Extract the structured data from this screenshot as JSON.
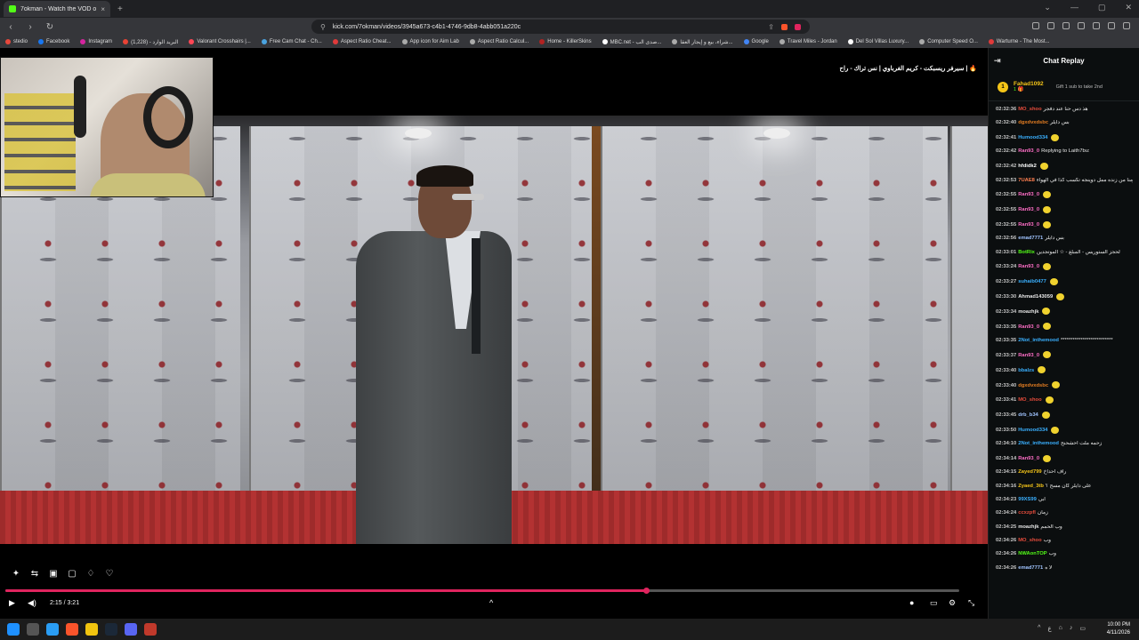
{
  "browser": {
    "tab_title": "7okman - Watch the VOD on...",
    "tab_close": "×",
    "new_tab": "+",
    "url": "kick.com/7okman/videos/3945a673-c4b1-4746-9db8-4abb051a220c",
    "bookmarks": [
      {
        "label": "stedio",
        "color": "#e8483c"
      },
      {
        "label": "Facebook",
        "color": "#1877f2"
      },
      {
        "label": "Instagram",
        "color": "#d6249f"
      },
      {
        "label": "البريد الوارد - (1,228)",
        "color": "#ea4335"
      },
      {
        "label": "Valorant Crosshairs |...",
        "color": "#ff4655"
      },
      {
        "label": "Free Cam Chat - Ch...",
        "color": "#4aa3df"
      },
      {
        "label": "Aspect Ratio Cheat...",
        "color": "#e03a3a"
      },
      {
        "label": "App icon for Aim Lab",
        "color": "#aaaaaa"
      },
      {
        "label": "Aspect Ratio Calcul...",
        "color": "#aaaaaa"
      },
      {
        "label": "Home - KillerSkins",
        "color": "#b22222"
      },
      {
        "label": "MBC.net - صدى الب...",
        "color": "#ffffff"
      },
      {
        "label": "شراء، بيع و إيجار العقا...",
        "color": "#aaaaaa"
      },
      {
        "label": "Google",
        "color": "#4285f4"
      },
      {
        "label": "Travel Miles - Jordan",
        "color": "#aaaaaa"
      },
      {
        "label": "Del Sol Villas Luxury...",
        "color": "#ffffff"
      },
      {
        "label": "Computer Speed O...",
        "color": "#aaaaaa"
      },
      {
        "label": "Warturne - The Most...",
        "color": "#e03a3a"
      }
    ]
  },
  "player": {
    "video_title": "🔥 | سيرفر ريسبكت - كريم الغرباوي | نس تراك - راح",
    "time": "2:15 / 3:21",
    "progress_fraction": 0.672
  },
  "chat": {
    "title": "Chat Replay",
    "gifter": {
      "rank": "1",
      "name": "Fahad1092",
      "count": "1 🎁",
      "gift_text": "Gift 1 sub to take 2nd"
    },
    "messages": [
      {
        "ts": "02:32:36",
        "user": "MO_shoo",
        "color": "#e74c3c",
        "text": "هذ دس حنا عند دفجر"
      },
      {
        "ts": "02:32:40",
        "user": "dgxdvxdsbc",
        "color": "#e67e22",
        "text": "بس دايلر"
      },
      {
        "ts": "02:32:41",
        "user": "Humood334",
        "color": "#3ab0ff",
        "text": ""
      },
      {
        "ts": "02:32:42",
        "user": "Ran93_0",
        "color": "#ff6ec7",
        "text": "Replying to Laith7bu:"
      },
      {
        "ts": "02:32:42",
        "user": "hfdidk2",
        "color": "#ffffff",
        "text": ""
      },
      {
        "ts": "02:32:53",
        "user": "7UAE8",
        "color": "#ff7f50",
        "text": "بحول قولو له زمنا من زنده ممل دوينجه تكسب كذا في الهواء"
      },
      {
        "ts": "02:32:55",
        "user": "Ran93_0",
        "color": "#ff6ec7",
        "text": ""
      },
      {
        "ts": "02:32:55",
        "user": "Ran93_0",
        "color": "#ff6ec7",
        "text": ""
      },
      {
        "ts": "02:32:55",
        "user": "Ran93_0",
        "color": "#ff6ec7",
        "text": ""
      },
      {
        "ts": "02:32:56",
        "user": "emad7771",
        "color": "#a0c4ff",
        "text": "بس دايلر"
      },
      {
        "ts": "02:33:01",
        "user": "BotRix",
        "color": "#53fc18",
        "text": "لحجز الستوريس - المبلغ - ☆ الموتجدين"
      },
      {
        "ts": "02:33:24",
        "user": "Ran93_0",
        "color": "#ff6ec7",
        "text": ""
      },
      {
        "ts": "02:33:27",
        "user": "suhaib0477",
        "color": "#3ab0ff",
        "text": ""
      },
      {
        "ts": "02:33:30",
        "user": "Ahmad143059",
        "color": "#e8e8e8",
        "text": ""
      },
      {
        "ts": "02:33:34",
        "user": "moazhjk",
        "color": "#e8e8e8",
        "text": ""
      },
      {
        "ts": "02:33:35",
        "user": "Ran93_0",
        "color": "#ff6ec7",
        "text": ""
      },
      {
        "ts": "02:33:35",
        "user": "2Not_inthemood",
        "color": "#3ab0ff",
        "text": "**************************"
      },
      {
        "ts": "02:33:37",
        "user": "Ran93_0",
        "color": "#ff6ec7",
        "text": ""
      },
      {
        "ts": "02:33:40",
        "user": "bbalzs",
        "color": "#3ab0ff",
        "text": ""
      },
      {
        "ts": "02:33:40",
        "user": "dgxdvxdsbc",
        "color": "#e67e22",
        "text": ""
      },
      {
        "ts": "02:33:41",
        "user": "MO_shoo",
        "color": "#e74c3c",
        "text": ""
      },
      {
        "ts": "02:33:45",
        "user": "drb_b34",
        "color": "#a0c4ff",
        "text": ""
      },
      {
        "ts": "02:33:50",
        "user": "Humood334",
        "color": "#3ab0ff",
        "text": ""
      },
      {
        "ts": "02:34:10",
        "user": "2Not_inthemood",
        "color": "#3ab0ff",
        "text": "زحمه ملت احشحنح"
      },
      {
        "ts": "02:34:14",
        "user": "Ran93_0",
        "color": "#ff6ec7",
        "text": ""
      },
      {
        "ts": "02:34:15",
        "user": "Zayed799",
        "color": "#f5c518",
        "text": "راف احداخ"
      },
      {
        "ts": "02:34:16",
        "user": "Zyaed_3tb",
        "color": "#f5c518",
        "text": "على دايلر كان مسح ؟"
      },
      {
        "ts": "02:34:23",
        "user": "99XS99",
        "color": "#3ab0ff",
        "text": "ابي"
      },
      {
        "ts": "02:34:24",
        "user": "ccxzpfl",
        "color": "#e74c3c",
        "text": "زمان"
      },
      {
        "ts": "02:34:25",
        "user": "moazhjk",
        "color": "#e8e8e8",
        "text": "وب الحمم"
      },
      {
        "ts": "02:34:26",
        "user": "MO_shoo",
        "color": "#e74c3c",
        "text": "وب"
      },
      {
        "ts": "02:34:26",
        "user": "NWAonTOP",
        "color": "#53fc18",
        "text": "وب"
      },
      {
        "ts": "02:34:26",
        "user": "emad7771",
        "color": "#a0c4ff",
        "text": "لا ه"
      }
    ]
  },
  "taskbar": {
    "time": "10:00 PM",
    "date": "4/11/2026",
    "lang": "ع"
  }
}
